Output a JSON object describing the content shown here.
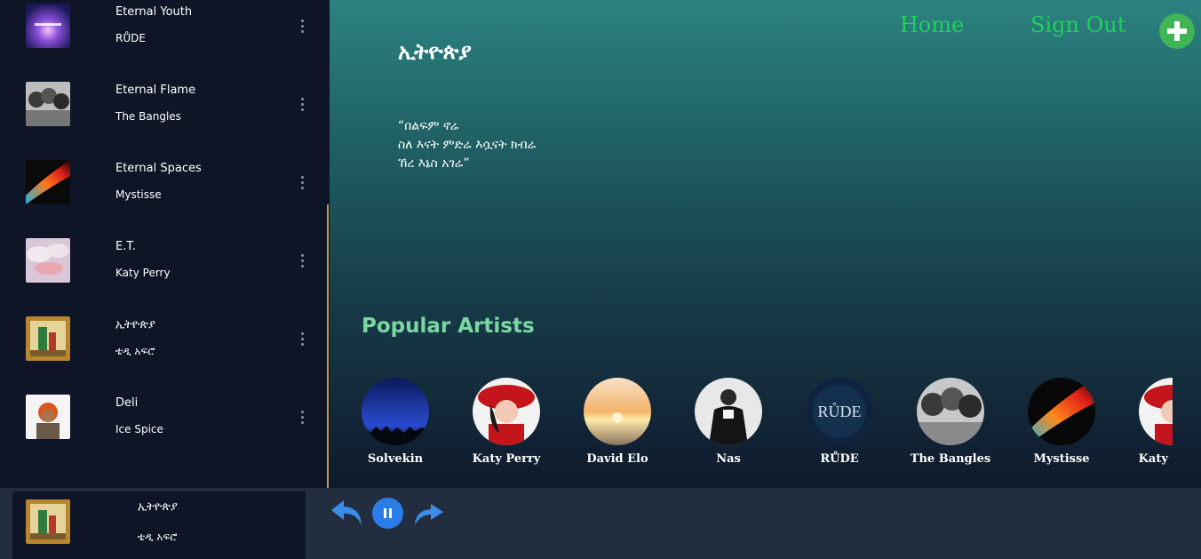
{
  "sidebar": {
    "songs": [
      {
        "title": "Eternal Youth",
        "artist": "RŮDE",
        "cover": "nebula-cover"
      },
      {
        "title": "Eternal Flame",
        "artist": "The Bangles",
        "cover": "bangles-cover"
      },
      {
        "title": "Eternal Spaces",
        "artist": "Mystisse",
        "cover": "fiery-wave-cover"
      },
      {
        "title": "E.T.",
        "artist": "Katy Perry",
        "cover": "clouds-cover"
      },
      {
        "title": "ኢትዮጵያ",
        "artist": "ቴዲ አፍሮ",
        "cover": "teddy-afro-cover"
      },
      {
        "title": "Deli",
        "artist": "Ice Spice",
        "cover": "ice-spice-cover"
      }
    ]
  },
  "nav": {
    "home_label": "Home",
    "signout_label": "Sign Out",
    "add_icon": "plus-icon"
  },
  "hero": {
    "title": "ኢትዮጵያ",
    "quote": "“በልፍም ኖሬ\nስለ እናት ምድሬ እሷናት ክብሬ\nኸረ እኔስ አገሬ”"
  },
  "popular": {
    "title": "Popular Artists",
    "artists": [
      {
        "name": "Solvekin"
      },
      {
        "name": "Katy Perry"
      },
      {
        "name": "David Elo"
      },
      {
        "name": "Nas"
      },
      {
        "name": "RŮDE"
      },
      {
        "name": "The Bangles"
      },
      {
        "name": "Mystisse"
      },
      {
        "name": "Katy Perry"
      }
    ]
  },
  "player": {
    "title": "ኢትዮጵያ",
    "artist": "ቴዲ አፍሮ",
    "controls": {
      "previous": "undo-arrow-icon",
      "pause": "pause-icon",
      "next": "redo-arrow-icon"
    }
  },
  "colors": {
    "accent_green": "#1fd05a",
    "section_title": "#7bd7a1",
    "play_blue": "#2a7de8",
    "add_green": "#3fb556"
  }
}
